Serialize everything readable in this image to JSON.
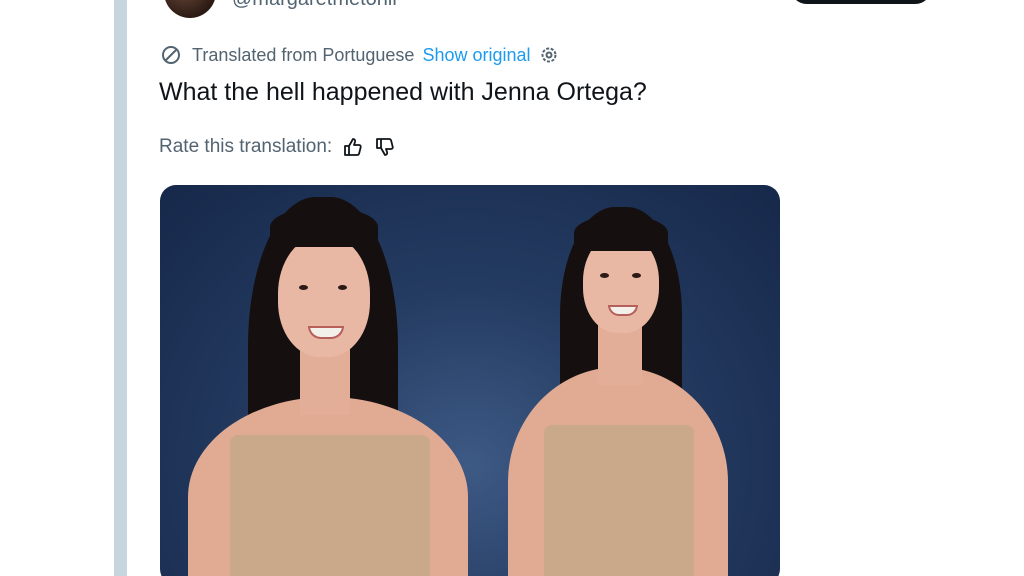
{
  "author": {
    "handle": "@margaretmetonii"
  },
  "translation": {
    "note": "Translated from Portuguese",
    "show_original": "Show original"
  },
  "tweet": {
    "text": "What the hell happened with Jenna Ortega?"
  },
  "rating": {
    "label": "Rate this translation:"
  },
  "icons": {
    "translate": "translate-icon",
    "settings": "gear-icon",
    "thumbs_up": "thumbs-up-icon",
    "thumbs_down": "thumbs-down-icon"
  },
  "colors": {
    "link": "#1d9bf0",
    "muted_text": "#536471",
    "primary_text": "#0f1419",
    "rail": "#c7d6de"
  }
}
